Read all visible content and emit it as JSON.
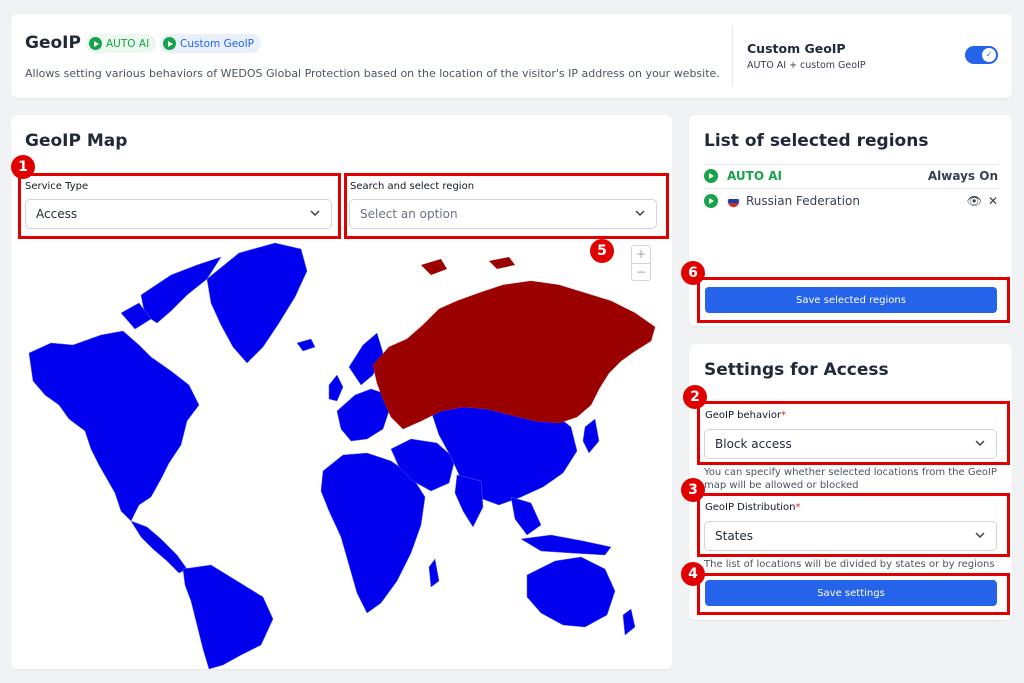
{
  "header": {
    "title": "GeoIP",
    "pill_auto": "AUTO AI",
    "pill_custom": "Custom GeoIP",
    "description": "Allows setting various behaviors of WEDOS Global Protection based on the location of the visitor's IP address on your website.",
    "mode_title": "Custom GeoIP",
    "mode_subtitle": "AUTO AI + custom GeoIP",
    "toggle_on": true
  },
  "map_section": {
    "title": "GeoIP Map",
    "service_type_label": "Service Type",
    "service_type_value": "Access",
    "region_label": "Search and select region",
    "region_placeholder": "Select an option",
    "zoom_in": "+",
    "zoom_out": "−",
    "colors": {
      "land": "#0000ee",
      "selected": "#9b0000"
    }
  },
  "regions": {
    "title": "List of selected regions",
    "items": [
      {
        "name": "AUTO AI",
        "status": "Always On"
      },
      {
        "name": "Russian Federation",
        "status": ""
      }
    ],
    "save_button": "Save selected regions"
  },
  "settings": {
    "title": "Settings for Access",
    "behavior_label": "GeoIP behavior",
    "behavior_value": "Block access",
    "behavior_help": "You can specify whether selected locations from the GeoIP map will be allowed or blocked",
    "distribution_label": "GeoIP Distribution",
    "distribution_value": "States",
    "distribution_help": "The list of locations will be divided by states or by regions",
    "save_button": "Save settings",
    "required_mark": "*"
  },
  "annotations": [
    "1",
    "2",
    "3",
    "4",
    "5",
    "6"
  ]
}
